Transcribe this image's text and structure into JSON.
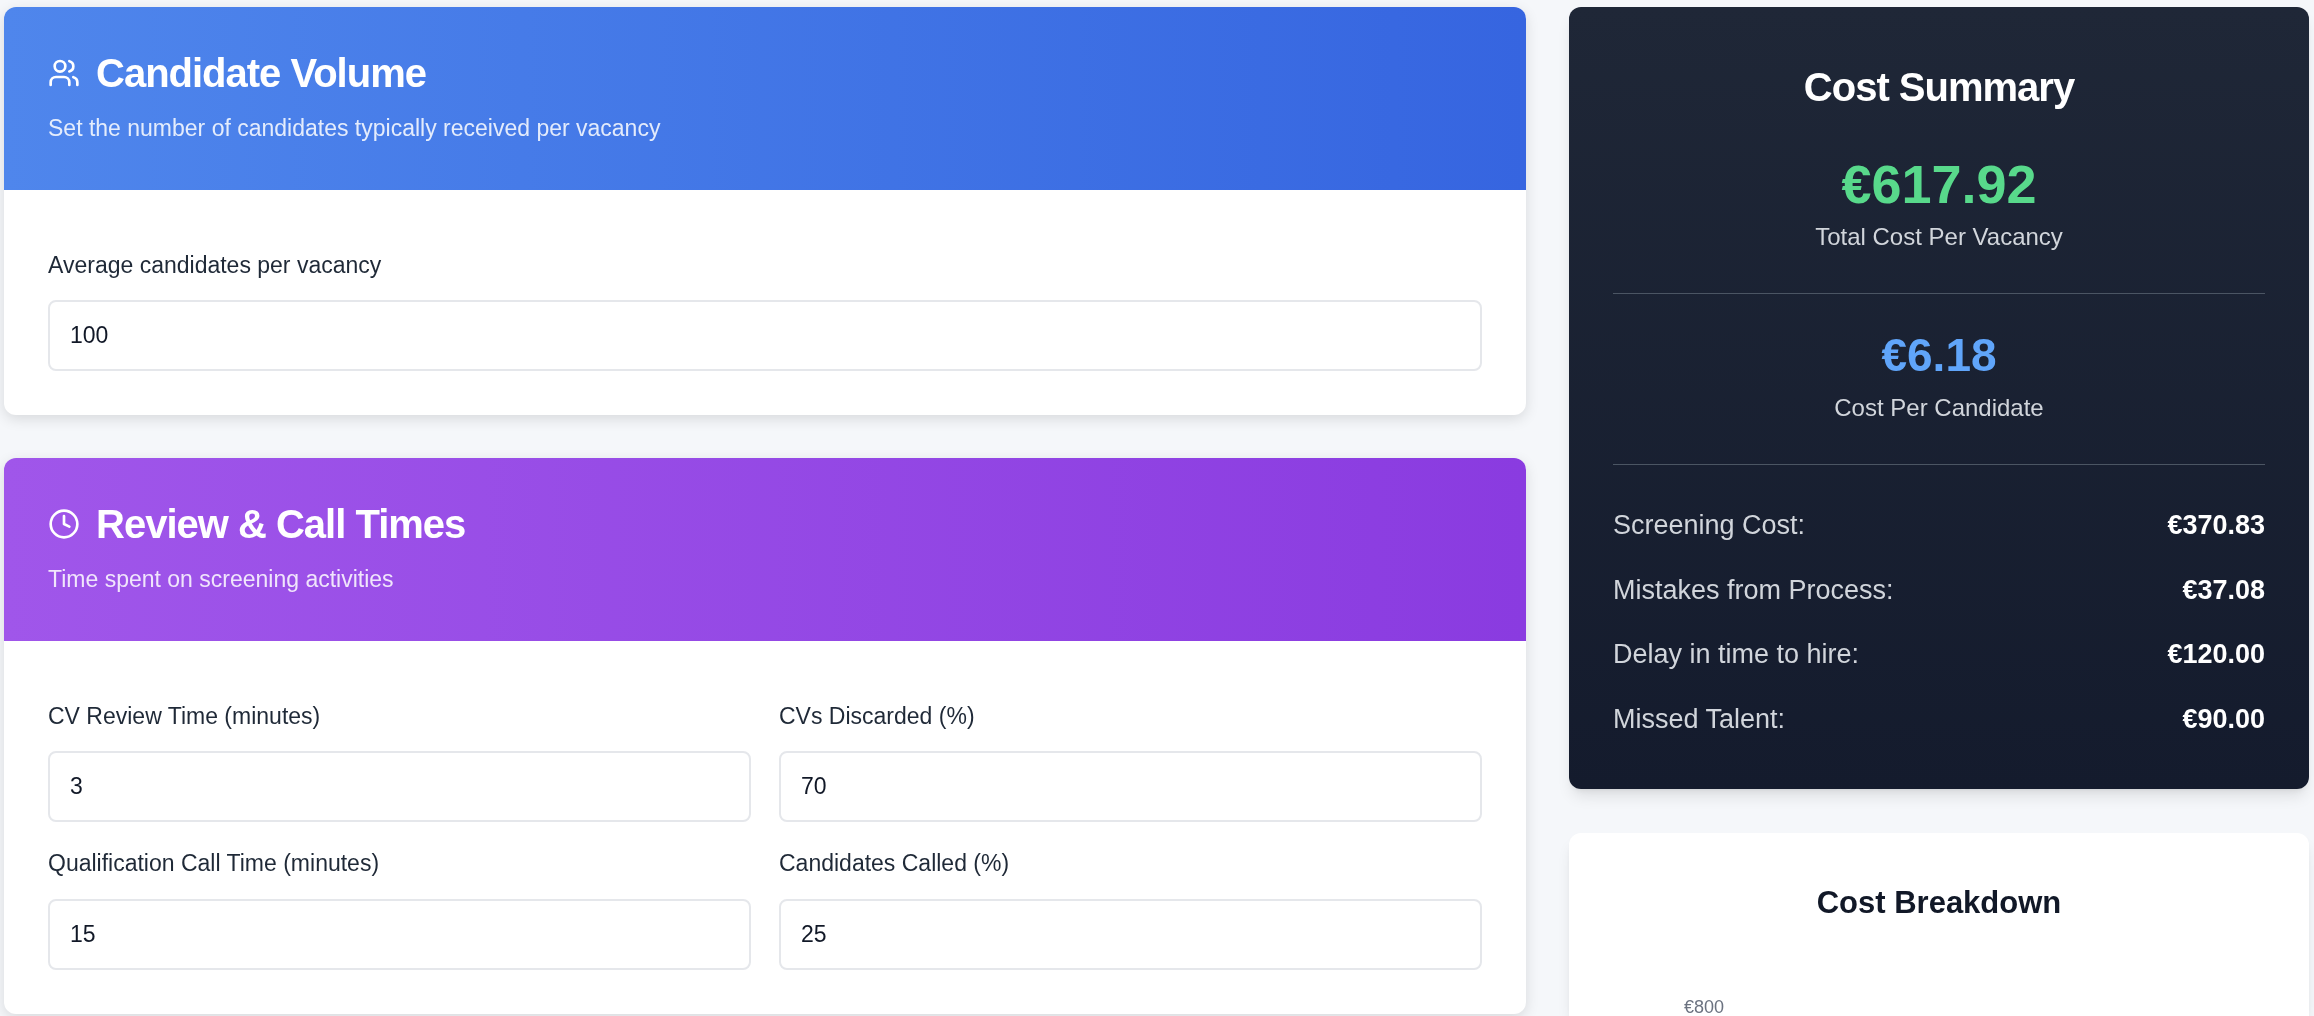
{
  "sections": [
    {
      "title": "Candidate Volume",
      "subtitle": "Set the number of candidates typically received per vacancy",
      "fields": [
        {
          "label": "Average candidates per vacancy",
          "value": "100"
        }
      ]
    },
    {
      "title": "Review & Call Times",
      "subtitle": "Time spent on screening activities",
      "fields": [
        {
          "label": "CV Review Time (minutes)",
          "value": "3"
        },
        {
          "label": "CVs Discarded (%)",
          "value": "70"
        },
        {
          "label": "Qualification Call Time (minutes)",
          "value": "15"
        },
        {
          "label": "Candidates Called (%)",
          "value": "25"
        }
      ]
    }
  ],
  "summary": {
    "title": "Cost Summary",
    "total": "€617.92",
    "total_label": "Total Cost Per Vacancy",
    "per_candidate": "€6.18",
    "per_candidate_label": "Cost Per Candidate",
    "rows": [
      {
        "label": "Screening Cost:",
        "value": "€370.83"
      },
      {
        "label": "Mistakes from Process:",
        "value": "€37.08"
      },
      {
        "label": "Delay in time to hire:",
        "value": "€120.00"
      },
      {
        "label": "Missed Talent:",
        "value": "€90.00"
      }
    ]
  },
  "breakdown": {
    "title": "Cost Breakdown",
    "y_tick": "€800"
  }
}
